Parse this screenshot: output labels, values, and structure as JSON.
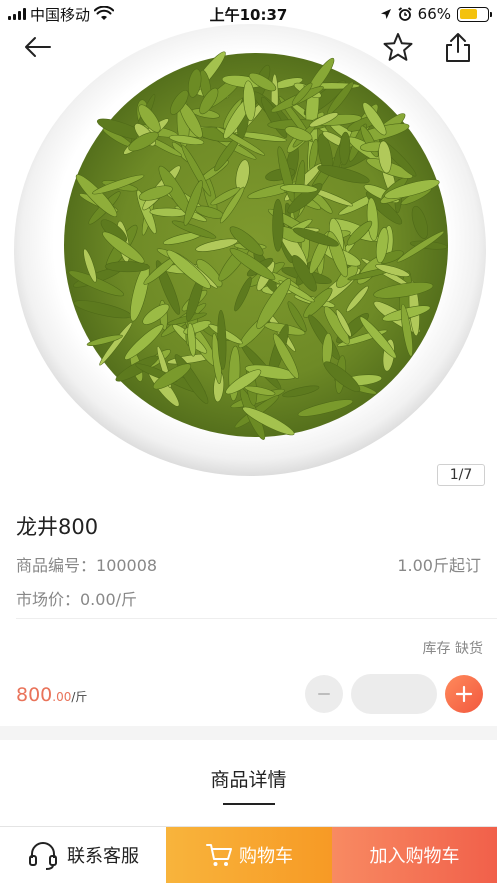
{
  "status_bar": {
    "carrier": "中国移动",
    "time": "上午10:37",
    "battery": "66%",
    "battery_level": 0.66,
    "icons": [
      "signal-icon",
      "wifi-icon",
      "location-icon",
      "alarm-icon",
      "battery-icon"
    ]
  },
  "nav": {
    "icons": [
      "back-arrow-icon",
      "star-icon",
      "share-icon"
    ]
  },
  "gallery": {
    "indicator": "1/7",
    "image": "green-tea-leaves-in-white-bowl"
  },
  "product": {
    "name": "龙井800",
    "code_label": "商品编号：",
    "code_value": "100008",
    "min_order": "1.00斤起订",
    "market_price": "市场价：0.00/斤",
    "stock_label": "库存",
    "stock_status": "缺货",
    "price_integer": "800",
    "price_decimal": ".00",
    "price_unit": "/斤"
  },
  "quantity": {
    "value": "",
    "placeholder": ""
  },
  "tabs": {
    "detail": "商品详情"
  },
  "bottom_bar": {
    "service": "联系客服",
    "cart": "购物车",
    "add_to_cart": "加入购物车",
    "icons": [
      "headset-icon",
      "cart-icon"
    ]
  },
  "colors": {
    "accent": "#f1604a",
    "cart_orange": "#f79a25",
    "price": "#e9735a",
    "battery": "#f4c20d"
  }
}
